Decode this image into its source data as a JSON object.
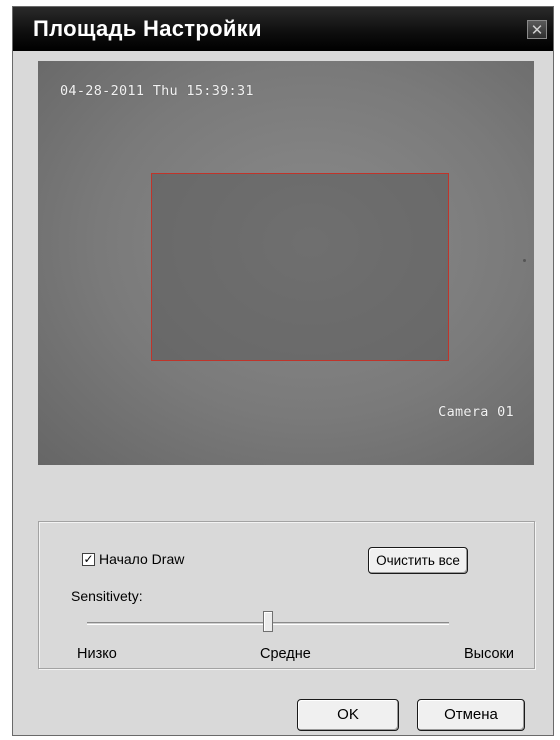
{
  "window": {
    "title": "Площадь Настройки",
    "close_glyph": "✕"
  },
  "video": {
    "timestamp": "04-28-2011 Thu 15:39:31",
    "camera_label": "Camera 01",
    "zone_color": "#c0342a"
  },
  "controls": {
    "start_draw": {
      "checked": true,
      "check_glyph": "✓",
      "label": "Начало Draw"
    },
    "clear_all_label": "Очистить все",
    "sensitivity": {
      "label": "Sensitivety:",
      "value": 0.5,
      "scale_labels": {
        "low": "Низко",
        "mid": "Средне",
        "high": "Высоки"
      }
    }
  },
  "footer": {
    "ok_label": "OK",
    "cancel_label": "Отмена"
  }
}
